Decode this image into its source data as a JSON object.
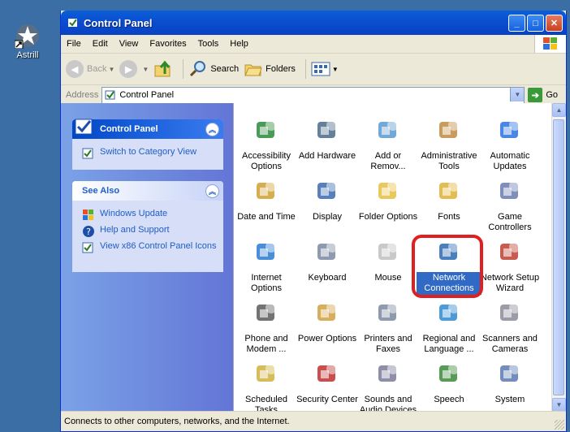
{
  "desktop": {
    "icon_label": "Astrill"
  },
  "window": {
    "title": "Control Panel"
  },
  "menu": [
    "File",
    "Edit",
    "View",
    "Favorites",
    "Tools",
    "Help"
  ],
  "toolbar": {
    "back": "Back",
    "search": "Search",
    "folders": "Folders"
  },
  "address": {
    "label": "Address",
    "value": "Control Panel",
    "go": "Go"
  },
  "side": {
    "cp_title": "Control Panel",
    "switch_link": "Switch to Category View",
    "see_also_title": "See Also",
    "see_also": [
      "Windows Update",
      "Help and Support",
      "View x86 Control Panel Icons"
    ]
  },
  "items": [
    [
      "Accessibility Options",
      "Add Hardware",
      "Add or Remov...",
      "Administrative Tools",
      "Automatic Updates"
    ],
    [
      "Date and Time",
      "Display",
      "Folder Options",
      "Fonts",
      "Game Controllers"
    ],
    [
      "Internet Options",
      "Keyboard",
      "Mouse",
      "Network Connections",
      "Network Setup Wizard"
    ],
    [
      "Phone and Modem ...",
      "Power Options",
      "Printers and Faxes",
      "Regional and Language ...",
      "Scanners and Cameras"
    ],
    [
      "Scheduled Tasks",
      "Security Center",
      "Sounds and Audio Devices",
      "Speech",
      "System"
    ]
  ],
  "selected_item": "Network Connections",
  "status": "Connects to other computers, networks, and the Internet.",
  "colors": {
    "title_bar": "#0a5fd8",
    "left_pane": "#6e8de0",
    "selection": "#316ac5",
    "highlight_box": "#e02020"
  }
}
